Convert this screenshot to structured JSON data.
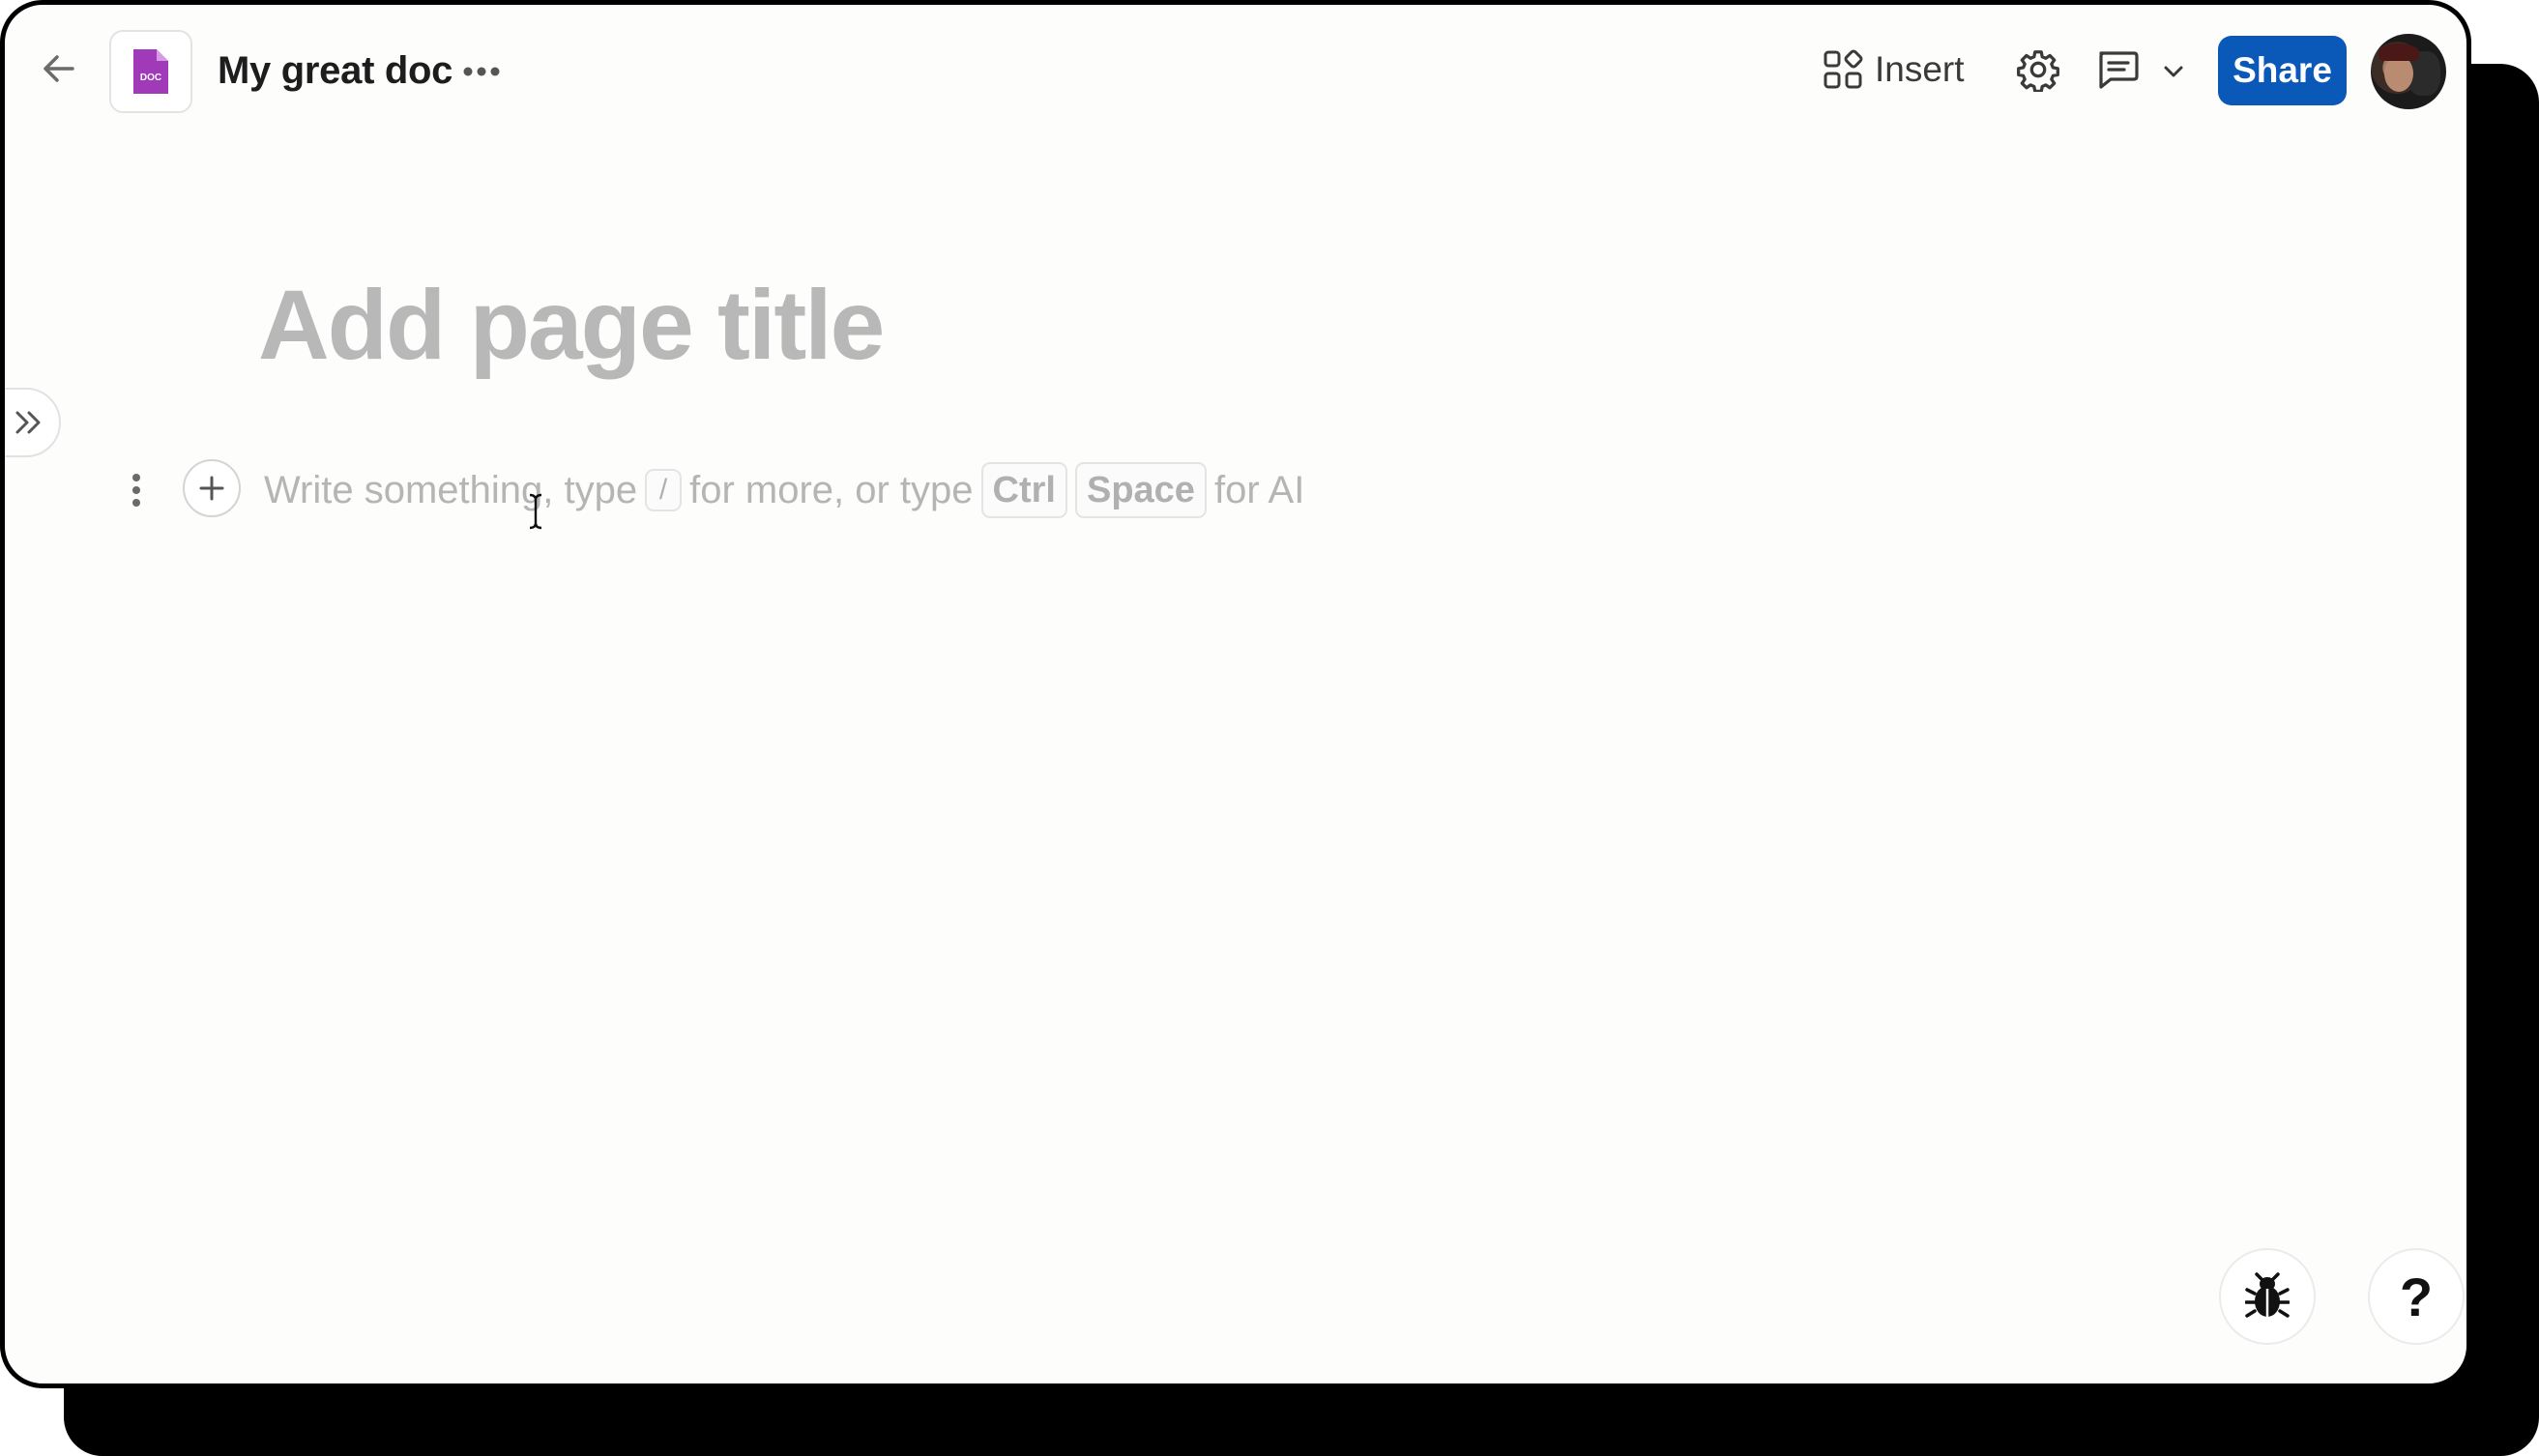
{
  "header": {
    "doc_title": "My great doc",
    "doc_icon_label": "DOC",
    "insert_label": "Insert",
    "share_label": "Share"
  },
  "editor": {
    "title_placeholder": "Add page title",
    "placeholder": {
      "part1": "Write something, type",
      "slash_key": "/",
      "part2": "for more, or type",
      "key_ctrl": "Ctrl",
      "key_space": "Space",
      "part3": "for AI"
    }
  },
  "floating": {
    "help_label": "?"
  },
  "colors": {
    "accent": "#0a58b8",
    "doc_icon": "#a03ab8",
    "placeholder_text": "#b5b5b5",
    "background": "#fdfdfc"
  },
  "icons": {
    "back": "arrow-left-icon",
    "doc": "doc-file-icon",
    "more": "ellipsis-icon",
    "insert": "grid-plus-icon",
    "settings": "gear-icon",
    "comments": "comment-icon",
    "dropdown": "chevron-down-icon",
    "sidebar": "double-chevron-right-icon",
    "drag": "vertical-dots-icon",
    "add": "plus-icon",
    "bug": "bug-icon"
  }
}
